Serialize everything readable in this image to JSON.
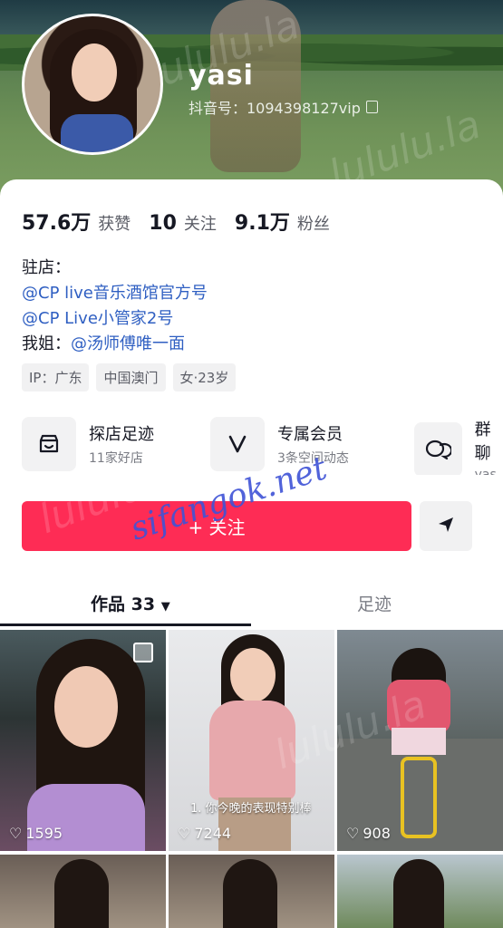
{
  "profile": {
    "name": "yasi",
    "douyin_id": "抖音号：1094398127vip"
  },
  "stats": [
    {
      "num": "57.6万",
      "label": "获赞"
    },
    {
      "num": "10",
      "label": "关注"
    },
    {
      "num": "9.1万",
      "label": "粉丝"
    }
  ],
  "bio": {
    "line1": "驻店：",
    "line2": "@CP live音乐酒馆官方号",
    "line3": "@CP Live小管家2号",
    "line4_prefix": "我姐：",
    "line4_link": "@汤师傅唯一面"
  },
  "tags": [
    "IP：广东",
    "中国澳门",
    "女·23岁"
  ],
  "features": [
    {
      "title": "探店足迹",
      "sub": "11家好店",
      "icon": "shop-icon"
    },
    {
      "title": "专属会员",
      "sub": "3条空间动态",
      "icon": "vip-icon"
    },
    {
      "title": "群聊",
      "sub": "yas",
      "icon": "chat-icon"
    }
  ],
  "actions": {
    "follow": "+ 关注",
    "share_icon": "send-icon"
  },
  "tabs": {
    "works": "作品 33",
    "footprint": "足迹"
  },
  "videos": [
    {
      "likes": "1595",
      "caption": ""
    },
    {
      "likes": "7244",
      "caption": "1. 你今晚的表现特别棒"
    },
    {
      "likes": "908",
      "caption": ""
    }
  ],
  "watermarks": {
    "site": "lululu.la",
    "stamp": "sifangok.net"
  },
  "colors": {
    "accent": "#fe2c55",
    "link": "#2f5fc2"
  }
}
